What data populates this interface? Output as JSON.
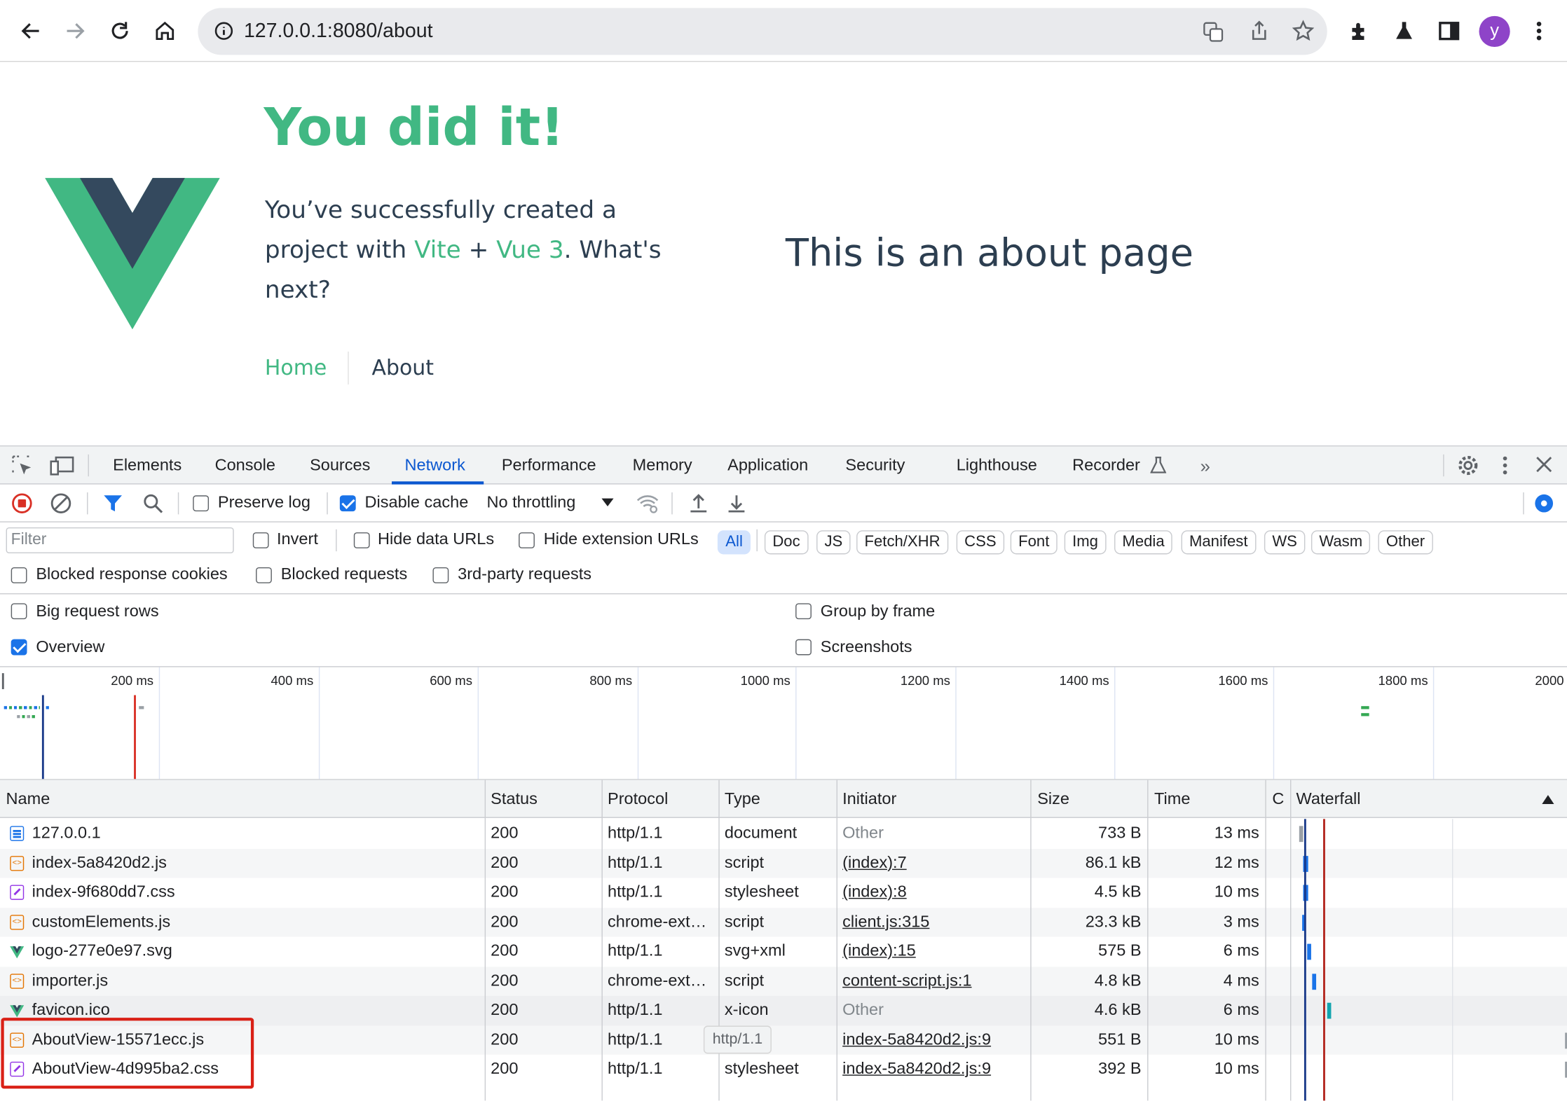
{
  "browser": {
    "url": "127.0.0.1:8080/about",
    "avatar_letter": "y"
  },
  "app": {
    "heading": "You did it!",
    "intro_1": "You’ve successfully created a",
    "intro_2a": "project with ",
    "vite_link": "Vite",
    "plus": " + ",
    "vue_link": "Vue 3",
    "intro_2b": ". What's",
    "intro_3": "next?",
    "nav_home": "Home",
    "nav_about": "About",
    "page_text": "This is an about page",
    "brand_green": "#42b883",
    "brand_dark": "#35495e"
  },
  "devtools": {
    "tabs": [
      "Elements",
      "Console",
      "Sources",
      "Network",
      "Performance",
      "Memory",
      "Application",
      "Security",
      "Lighthouse",
      "Recorder"
    ],
    "active_tab": "Network",
    "toolbar": {
      "preserve_log": "Preserve log",
      "disable_cache": "Disable cache",
      "throttling": "No throttling"
    },
    "filter": {
      "placeholder": "Filter",
      "invert": "Invert",
      "hide_data_urls": "Hide data URLs",
      "hide_extension_urls": "Hide extension URLs",
      "types": [
        "All",
        "Doc",
        "JS",
        "Fetch/XHR",
        "CSS",
        "Font",
        "Img",
        "Media",
        "Manifest",
        "WS",
        "Wasm",
        "Other"
      ]
    },
    "row2": {
      "blocked_cookies": "Blocked response cookies",
      "blocked_requests": "Blocked requests",
      "third_party": "3rd-party requests"
    },
    "settings": {
      "big_rows": "Big request rows",
      "group_by_frame": "Group by frame",
      "overview": "Overview",
      "screenshots": "Screenshots"
    },
    "overview_ticks": [
      "200 ms",
      "400 ms",
      "600 ms",
      "800 ms",
      "1000 ms",
      "1200 ms",
      "1400 ms",
      "1600 ms",
      "1800 ms",
      "2000"
    ],
    "columns": {
      "name": "Name",
      "status": "Status",
      "protocol": "Protocol",
      "type": "Type",
      "initiator": "Initiator",
      "size": "Size",
      "time": "Time",
      "c": "C",
      "waterfall": "Waterfall"
    },
    "requests": [
      {
        "icon": "doc",
        "name": "127.0.0.1",
        "status": "200",
        "protocol": "http/1.1",
        "type": "document",
        "initiator": "Other",
        "size": "733 B",
        "time": "13 ms"
      },
      {
        "icon": "script",
        "name": "index-5a8420d2.js",
        "status": "200",
        "protocol": "http/1.1",
        "type": "script",
        "initiator": "(index):7",
        "size": "86.1 kB",
        "time": "12 ms"
      },
      {
        "icon": "css",
        "name": "index-9f680dd7.css",
        "status": "200",
        "protocol": "http/1.1",
        "type": "stylesheet",
        "initiator": "(index):8",
        "size": "4.5 kB",
        "time": "10 ms"
      },
      {
        "icon": "script",
        "name": "customElements.js",
        "status": "200",
        "protocol": "chrome-ext…",
        "type": "script",
        "initiator": "client.js:315",
        "size": "23.3 kB",
        "time": "3 ms"
      },
      {
        "icon": "vue",
        "name": "logo-277e0e97.svg",
        "status": "200",
        "protocol": "http/1.1",
        "type": "svg+xml",
        "initiator": "(index):15",
        "size": "575 B",
        "time": "6 ms"
      },
      {
        "icon": "script",
        "name": "importer.js",
        "status": "200",
        "protocol": "chrome-ext…",
        "type": "script",
        "initiator": "content-script.js:1",
        "size": "4.8 kB",
        "time": "4 ms"
      },
      {
        "icon": "vue",
        "name": "favicon.ico",
        "status": "200",
        "protocol": "http/1.1",
        "type": "x-icon",
        "initiator": "Other",
        "size": "4.6 kB",
        "time": "6 ms"
      },
      {
        "icon": "script",
        "name": "AboutView-15571ecc.js",
        "status": "200",
        "protocol": "http/1.1",
        "type": "",
        "initiator": "index-5a8420d2.js:9",
        "size": "551 B",
        "time": "10 ms"
      },
      {
        "icon": "css",
        "name": "AboutView-4d995ba2.css",
        "status": "200",
        "protocol": "http/1.1",
        "type": "stylesheet",
        "initiator": "index-5a8420d2.js:9",
        "size": "392 B",
        "time": "10 ms"
      }
    ],
    "tooltip": "http/1.1"
  }
}
